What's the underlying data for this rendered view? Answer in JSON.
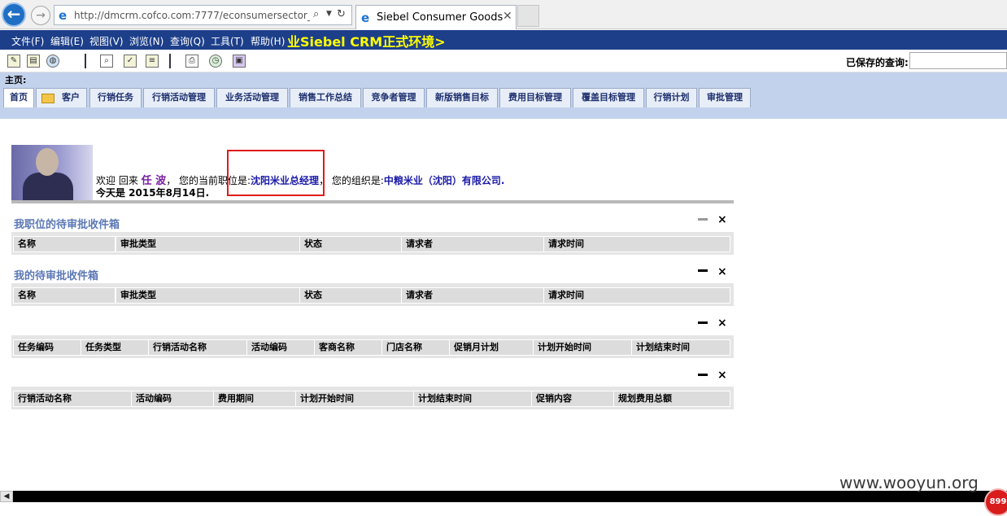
{
  "browser": {
    "url": "http://dmcrm.cofco.com:7777/econsumersector_c",
    "tab_title": "Siebel Consumer Goods",
    "tab_close": "✕"
  },
  "menu": {
    "items": [
      "文件(F)",
      "编辑(E)",
      "视图(V)",
      "浏览(N)",
      "查询(Q)",
      "工具(T)",
      "帮助(H)"
    ],
    "app_title": "业Siebel CRM正式环境>"
  },
  "toolbar": {
    "saved_query_label": "已保存的查询:",
    "saved_query_value": ""
  },
  "breadcrumb": "主页:",
  "nav_tabs": [
    "首页",
    "客户",
    "行销任务",
    "行销活动管理",
    "业务活动管理",
    "销售工作总结",
    "竞争者管理",
    "新版销售目标",
    "费用目标管理",
    "覆盖目标管理",
    "行销计划",
    "审批管理"
  ],
  "welcome": {
    "prefix": "欢迎 回来",
    "user_name": "任 波",
    "position_label": "，  您的当前职位是:",
    "position": "沈阳米业总经理",
    "org_label": "，  您的组织是:",
    "org": "中粮米业（沈阳）有限公司.",
    "date_line": "今天是 2015年8月14日."
  },
  "applets": {
    "position_inbox": {
      "title": "我职位的待审批收件箱",
      "columns": [
        "名称",
        "审批类型",
        "状态",
        "请求者",
        "请求时间"
      ]
    },
    "my_inbox": {
      "title": "我的待审批收件箱",
      "columns": [
        "名称",
        "审批类型",
        "状态",
        "请求者",
        "请求时间"
      ]
    },
    "tasks": {
      "columns": [
        "任务编码",
        "任务类型",
        "行销活动名称",
        "活动编码",
        "客商名称",
        "门店名称",
        "促销月计划",
        "计划开始时间",
        "计划结束时间"
      ]
    },
    "campaigns": {
      "columns": [
        "行销活动名称",
        "活动编码",
        "费用期间",
        "计划开始时间",
        "计划结束时间",
        "促销内容",
        "规划费用总额"
      ]
    },
    "close_glyph": "×"
  },
  "watermark": "www.wooyun.org",
  "badge": "899"
}
